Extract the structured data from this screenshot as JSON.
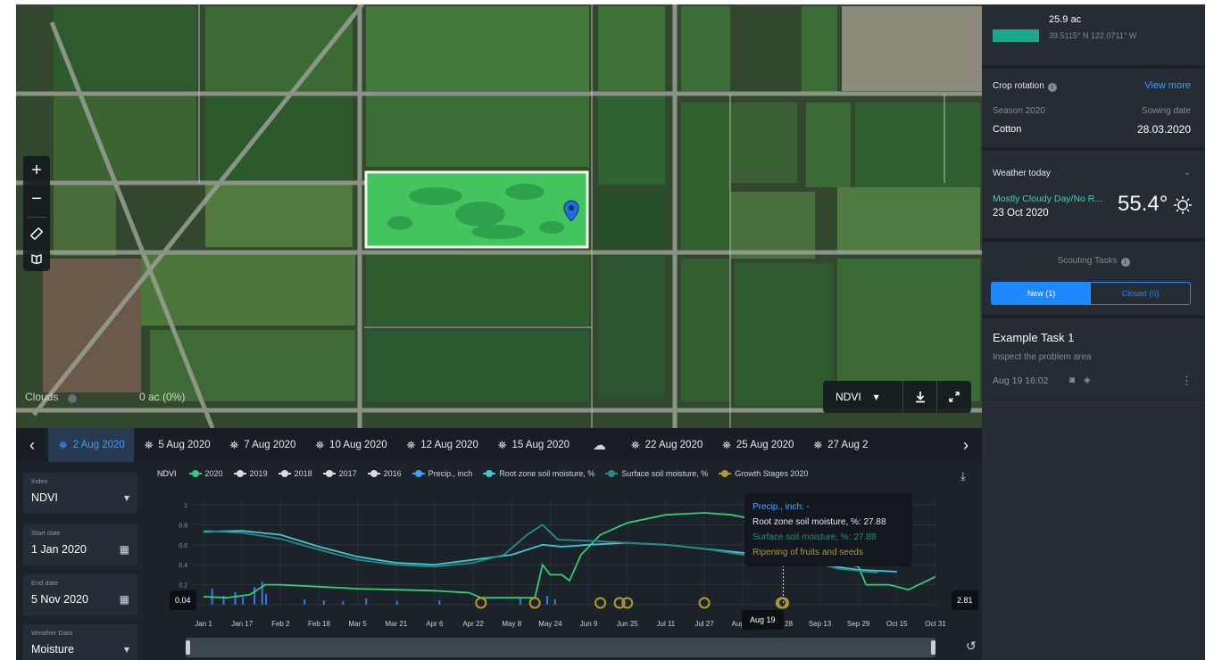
{
  "map": {
    "tools": {
      "zoom_in": "+",
      "zoom_out": "−"
    },
    "caption_left": "Clouds",
    "caption_center": "0 ac (0%)",
    "layer": {
      "selected": "NDVI"
    }
  },
  "dates": {
    "items": [
      {
        "label": "2 Aug 2020",
        "active": true
      },
      {
        "label": "5 Aug 2020",
        "active": false
      },
      {
        "label": "7 Aug 2020",
        "active": false
      },
      {
        "label": "10 Aug 2020",
        "active": false
      },
      {
        "label": "12 Aug 2020",
        "active": false
      },
      {
        "label": "15 Aug 2020",
        "active": false
      },
      {
        "label": "",
        "cloud": true
      },
      {
        "label": "22 Aug 2020",
        "active": false
      },
      {
        "label": "25 Aug 2020",
        "active": false
      },
      {
        "label": "27 Aug 2",
        "active": false
      }
    ]
  },
  "controls": {
    "index": {
      "label": "Index",
      "value": "NDVI"
    },
    "start_date": {
      "label": "Start date",
      "value": "1 Jan 2020"
    },
    "end_date": {
      "label": "End date",
      "value": "5 Nov 2020"
    },
    "weather_data": {
      "label": "Weather Data",
      "value": "Moisture"
    }
  },
  "chart": {
    "index_label": "NDVI",
    "legend": [
      {
        "label": "2020",
        "color": "#2ecf75"
      },
      {
        "label": "2019",
        "color": "#d9dde1"
      },
      {
        "label": "2018",
        "color": "#d9dde1"
      },
      {
        "label": "2017",
        "color": "#d9dde1"
      },
      {
        "label": "2016",
        "color": "#d9dde1"
      },
      {
        "label": "Precip., inch",
        "color": "#3f9cff"
      },
      {
        "label": "Root zone soil moisture, %",
        "color": "#3fc7d8"
      },
      {
        "label": "Surface soil moisture, %",
        "color": "#2a8a86"
      },
      {
        "label": "Growth Stages 2020",
        "color": "#b39a2d"
      }
    ],
    "tooltip": {
      "precip": "Precip., inch: -",
      "root": "Root zone soil moisture, %: 27.88",
      "surface": "Surface soil moisture, %: 27.88",
      "stage": "Ripening of fruits and seeds"
    },
    "range_left": "0.04",
    "range_right": "2.81",
    "hover_date": "Aug 19"
  },
  "chart_data": {
    "type": "line",
    "x_ticks": [
      "Jan 1",
      "Jan 17",
      "Feb 2",
      "Feb 18",
      "Mar 5",
      "Mar 21",
      "Apr 6",
      "Apr 22",
      "May 8",
      "May 24",
      "Jun 9",
      "Jun 25",
      "Jul 11",
      "Jul 27",
      "Aug 12",
      "Aug 28",
      "Sep 13",
      "Sep 29",
      "Oct 15",
      "Oct 31"
    ],
    "y_ticks": [
      "1",
      "0.8",
      "0.6",
      "0.4",
      "0.2",
      "0"
    ],
    "ylim": [
      0,
      1
    ],
    "series": [
      {
        "name": "2020",
        "color": "#2ecf75",
        "points": [
          [
            0,
            0.08
          ],
          [
            0.6,
            0.07
          ],
          [
            1.2,
            0.1
          ],
          [
            1.6,
            0.2
          ],
          [
            2,
            0.2
          ],
          [
            3,
            0.18
          ],
          [
            4,
            0.16
          ],
          [
            5,
            0.15
          ],
          [
            6,
            0.14
          ],
          [
            6.9,
            0.12
          ],
          [
            7.2,
            0.07
          ],
          [
            8.6,
            0.07
          ],
          [
            8.8,
            0.4
          ],
          [
            9,
            0.3
          ],
          [
            9.3,
            0.3
          ],
          [
            9.5,
            0.24
          ],
          [
            9.8,
            0.5
          ],
          [
            10.3,
            0.7
          ],
          [
            11,
            0.82
          ],
          [
            12,
            0.9
          ],
          [
            13,
            0.92
          ],
          [
            13.7,
            0.9
          ],
          [
            14.5,
            0.84
          ],
          [
            14.8,
            0.78
          ],
          [
            15.2,
            0.62
          ],
          [
            15.8,
            0.5
          ],
          [
            16.2,
            0.45
          ],
          [
            17,
            0.38
          ],
          [
            17.2,
            0.2
          ],
          [
            17.8,
            0.2
          ],
          [
            18.3,
            0.15
          ],
          [
            19,
            0.28
          ]
        ]
      },
      {
        "name": "Root zone soil moisture, %",
        "color": "#3fc7d8",
        "points": [
          [
            0,
            0.73
          ],
          [
            1,
            0.74
          ],
          [
            2,
            0.7
          ],
          [
            3,
            0.58
          ],
          [
            4,
            0.48
          ],
          [
            5,
            0.42
          ],
          [
            6,
            0.4
          ],
          [
            7,
            0.45
          ],
          [
            8,
            0.5
          ],
          [
            8.8,
            0.6
          ],
          [
            9.3,
            0.58
          ],
          [
            10,
            0.6
          ],
          [
            11,
            0.62
          ],
          [
            12,
            0.6
          ],
          [
            13,
            0.56
          ],
          [
            14,
            0.52
          ],
          [
            14.9,
            0.47
          ],
          [
            15.4,
            0.46
          ],
          [
            16,
            0.4
          ],
          [
            17,
            0.35
          ],
          [
            18,
            0.33
          ]
        ]
      },
      {
        "name": "Surface soil moisture, %",
        "color": "#2a8a86",
        "points": [
          [
            0,
            0.74
          ],
          [
            1,
            0.72
          ],
          [
            2,
            0.66
          ],
          [
            3,
            0.55
          ],
          [
            4,
            0.45
          ],
          [
            5,
            0.4
          ],
          [
            6,
            0.38
          ],
          [
            7,
            0.42
          ],
          [
            7.8,
            0.5
          ],
          [
            8.4,
            0.7
          ],
          [
            8.8,
            0.8
          ],
          [
            9.2,
            0.65
          ],
          [
            10,
            0.64
          ],
          [
            11,
            0.62
          ],
          [
            12,
            0.6
          ],
          [
            13,
            0.56
          ],
          [
            14,
            0.5
          ],
          [
            14.9,
            0.47
          ],
          [
            15.5,
            0.45
          ],
          [
            16.5,
            0.36
          ],
          [
            17.5,
            0.32
          ]
        ]
      }
    ],
    "growth_stage_markers_x": [
      7.2,
      8.6,
      10.3,
      10.8,
      11,
      13,
      15,
      15.05
    ],
    "precip_bars_x": [
      0.2,
      0.5,
      0.8,
      1.0,
      1.3,
      1.5,
      1.6,
      2.6,
      3.1,
      3.6,
      4.2,
      5.0,
      6.1,
      7.3,
      8.2,
      8.9,
      9.1
    ]
  },
  "sidebar": {
    "field": {
      "area": "25.9 ac",
      "coords": "39.5115° N 122.0711° W",
      "color": "#1ea68c"
    },
    "crop": {
      "title": "Crop rotation",
      "link": "View more",
      "season_label": "Season 2020",
      "sowing_label": "Sowing date",
      "crop": "Cotton",
      "sowing_date": "28.03.2020"
    },
    "weather": {
      "title": "Weather today",
      "desc": "Mostly Cloudy Day/No R...",
      "date": "23 Oct 2020",
      "temp": "55.4°"
    },
    "scouting": {
      "title": "Scouting Tasks",
      "new": "New (1)",
      "closed": "Closed (0)"
    },
    "task": {
      "title": "Example Task 1",
      "desc": "Inspect the problem area",
      "time": "Aug 19 16:02"
    }
  }
}
